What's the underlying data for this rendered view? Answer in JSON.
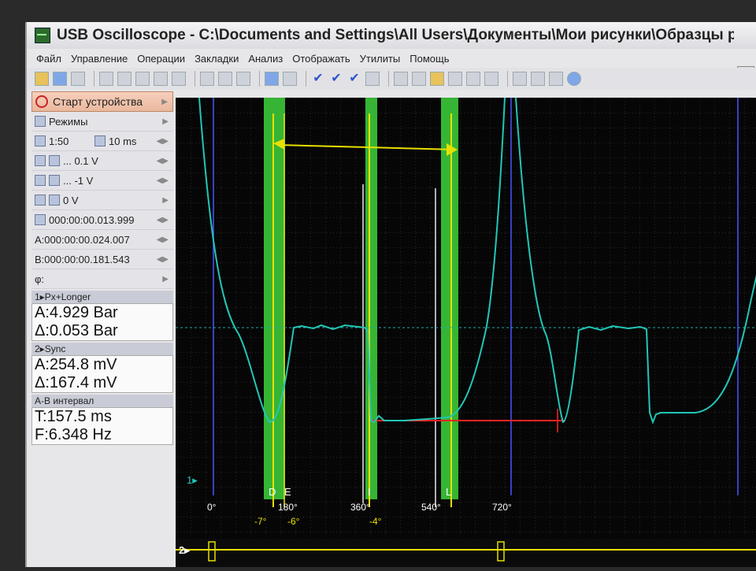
{
  "window": {
    "title": "USB Oscilloscope - C:\\Documents and Settings\\All Users\\Документы\\Мои рисунки\\Образцы рисунк..."
  },
  "menu": [
    "Файл",
    "Управление",
    "Операции",
    "Закладки",
    "Анализ",
    "Отображать",
    "Утилиты",
    "Помощь"
  ],
  "panel": {
    "start": "Старт устройства",
    "modes": "Режимы",
    "zoom": "1:50",
    "timebase": "10 ms",
    "ch1_scale": "... 0.1 V",
    "ch2_scale": "... -1 V",
    "trigger": "0 V",
    "time1": "000:00:00.013.999",
    "cursor_a": "A:000:00:00.024.007",
    "cursor_b": "B:000:00:00.181.543",
    "phi": "φ:",
    "ch1_name": "1▸Px+Longer",
    "ch1_a": "A:4.929 Bar",
    "ch1_d": "Δ:0.053 Bar",
    "ch2_name": "2▸Sync",
    "ch2_a": "A:254.8 mV",
    "ch2_d": "Δ:167.4 mV",
    "ab_name": "A-B интервал",
    "ab_t": "T:157.5 ms",
    "ab_f": "F:6.348 Hz",
    "ch1_marker": "1▸",
    "ch2_marker": "2▸"
  },
  "markers": {
    "D": "D",
    "E": "E",
    "I": "I",
    "L": "L",
    "deg0": "0°",
    "deg180": "180°",
    "deg360": "360°",
    "deg540": "540°",
    "deg720": "720°",
    "m7": "-7°",
    "m6": "-6°",
    "m4": "-4°"
  },
  "colors": {
    "trace": "#22c6b6",
    "marker_band": "#36b535",
    "cursor": "#e6e000",
    "phase_line": "#4a55ff",
    "red_line": "#ff2222"
  }
}
